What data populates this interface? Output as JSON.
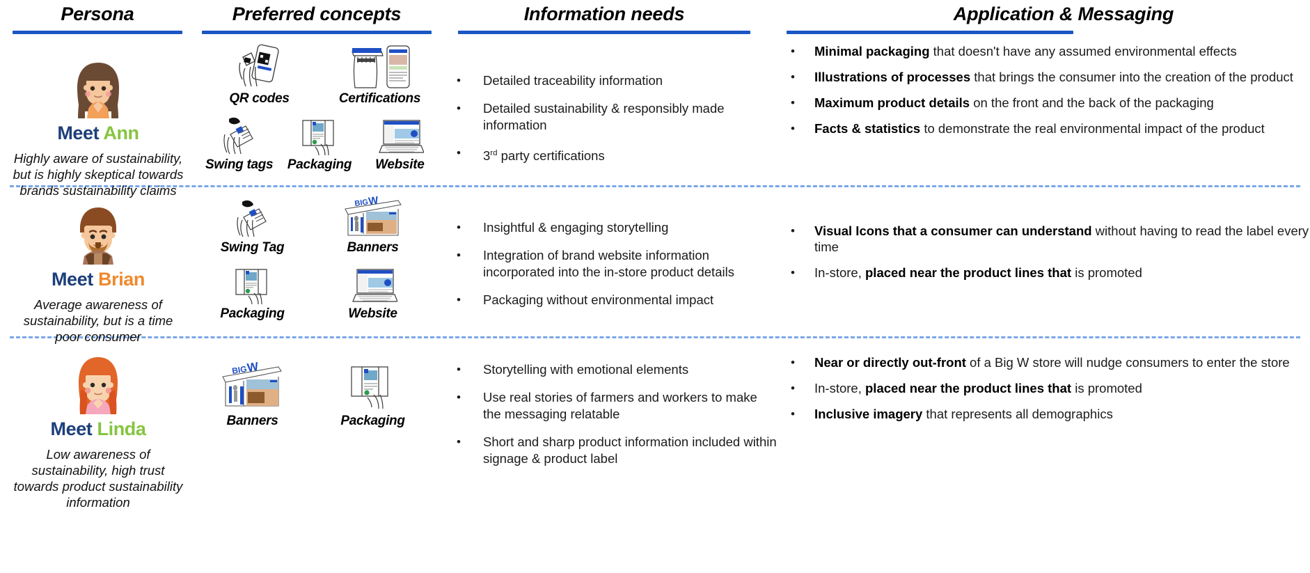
{
  "columns": [
    {
      "id": "persona",
      "title": "Persona",
      "accent": "#1a56c4"
    },
    {
      "id": "concepts",
      "title": "Preferred concepts",
      "accent": "#1a56c4"
    },
    {
      "id": "needs",
      "title": "Information needs",
      "accent": "#1a56c4"
    },
    {
      "id": "messaging",
      "title": "Application & Messaging",
      "accent": "#1a56c4"
    }
  ],
  "rows": [
    {
      "persona": {
        "meet_word": "Meet",
        "name": "Ann",
        "name_color": "#86c440",
        "meet_color": "#1d3f7a",
        "description": "Highly aware of sustainability, but is highly skeptical towards brands sustainability claims",
        "avatar": "woman-brown-hair-avatar"
      },
      "concepts": [
        {
          "label": "QR codes",
          "icon": "qr-code-phone-icon"
        },
        {
          "label": "Certifications",
          "icon": "certification-tag-phone-icon"
        },
        {
          "label": "Swing tags",
          "icon": "swing-tag-icon"
        },
        {
          "label": "Packaging",
          "icon": "packaging-icon"
        },
        {
          "label": "Website",
          "icon": "laptop-website-icon"
        }
      ],
      "needs": [
        "Detailed traceability information",
        "Detailed sustainability & responsibly made information",
        "3rd party certifications"
      ],
      "messaging": [
        {
          "bold": "Minimal packaging",
          "rest": " that doesn't have any assumed environmental effects",
          "bold_first": true
        },
        {
          "bold": "Illustrations of processes",
          "rest": " that brings the consumer into the creation of the product",
          "bold_first": true
        },
        {
          "bold": "Maximum product details",
          "rest": " on the front and the back of the packaging",
          "bold_first": true
        },
        {
          "bold": "Facts & statistics",
          "rest": " to demonstrate the real environmental impact of the product",
          "bold_first": true
        }
      ]
    },
    {
      "persona": {
        "meet_word": "Meet",
        "name": "Brian",
        "name_color": "#f0892e",
        "meet_color": "#1d3f7a",
        "description": "Average awareness of sustainability, but is a time poor consumer",
        "avatar": "man-beard-avatar"
      },
      "concepts": [
        {
          "label": "Swing Tag",
          "icon": "swing-tag-icon"
        },
        {
          "label": "Banners",
          "icon": "store-banner-icon"
        },
        {
          "label": "Packaging",
          "icon": "packaging-icon"
        },
        {
          "label": "Website",
          "icon": "laptop-website-icon"
        }
      ],
      "needs": [
        "Insightful & engaging storytelling",
        "Integration of brand website information incorporated into the in-store product details",
        "Packaging without environmental impact"
      ],
      "messaging": [
        {
          "bold": "Visual Icons that a consumer can understand",
          "rest": " without having to read the label every time",
          "bold_first": true
        },
        {
          "pre": "In-store, ",
          "bold": "placed near the product lines that",
          "rest": " is promoted",
          "bold_first": false
        }
      ]
    },
    {
      "persona": {
        "meet_word": "Meet",
        "name": "Linda",
        "name_color": "#86c440",
        "meet_color": "#1d3f7a",
        "description": "Low awareness of sustainability, high trust towards product sustainability information",
        "avatar": "woman-red-hair-avatar"
      },
      "concepts": [
        {
          "label": "Banners",
          "icon": "store-banner-icon"
        },
        {
          "label": "Packaging",
          "icon": "packaging-icon"
        }
      ],
      "needs": [
        "Storytelling with emotional elements",
        "Use real stories of farmers and workers to make the messaging relatable",
        "Short and sharp product information included within signage & product label"
      ],
      "messaging": [
        {
          "bold": "Near or directly out-front",
          "rest": " of a Big W store will nudge consumers to enter the store",
          "bold_first": true
        },
        {
          "pre": "In-store, ",
          "bold": "placed near the product lines that",
          "rest": " is promoted",
          "bold_first": false
        },
        {
          "bold": "Inclusive imagery",
          "rest": " that represents all demographics",
          "bold_first": true
        }
      ]
    }
  ],
  "brand": {
    "big_w_text_1": "BIG",
    "big_w_text_2": "W",
    "big_w_color": "#1f4fc4"
  }
}
